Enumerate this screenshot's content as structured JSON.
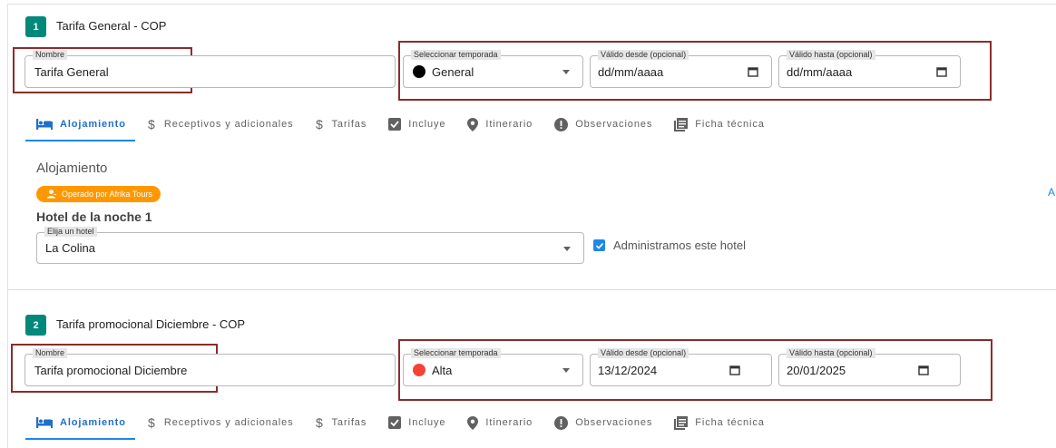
{
  "cards": [
    {
      "number": "1",
      "title": "Tarifa General - COP",
      "nombre": {
        "label": "Nombre",
        "value": "Tarifa General"
      },
      "temporada": {
        "label": "Seleccionar temporada",
        "value": "General",
        "color": "#000000"
      },
      "valido_desde": {
        "label": "Válido desde (opcional)",
        "value": "dd/mm/aaaa"
      },
      "valido_hasta": {
        "label": "Válido hasta (opcional)",
        "value": "dd/mm/aaaa"
      },
      "tabs": [
        "Alojamiento",
        "Receptivos y adicionales",
        "Tarifas",
        "Incluye",
        "Itinerario",
        "Observaciones",
        "Ficha técnica"
      ],
      "active_tab": "Alojamiento",
      "section_heading": "Alojamiento",
      "operator_badge": "Operado por Afrika Tours",
      "hotel_heading": "Hotel de la noche 1",
      "hotel_select": {
        "label": "Elija un hotel",
        "value": "La Colina"
      },
      "administramos": {
        "label": "Administramos este hotel",
        "checked": true
      },
      "edge_link": "A"
    },
    {
      "number": "2",
      "title": "Tarifa promocional Diciembre - COP",
      "nombre": {
        "label": "Nombre",
        "value": "Tarifa promocional Diciembre"
      },
      "temporada": {
        "label": "Seleccionar temporada",
        "value": "Alta",
        "color": "#f44336"
      },
      "valido_desde": {
        "label": "Válido desde (opcional)",
        "value": "13/12/2024"
      },
      "valido_hasta": {
        "label": "Válido hasta (opcional)",
        "value": "20/01/2025"
      },
      "tabs": [
        "Alojamiento",
        "Receptivos y adicionales",
        "Tarifas",
        "Incluye",
        "Itinerario",
        "Observaciones",
        "Ficha técnica"
      ],
      "active_tab": "Alojamiento"
    }
  ],
  "colors": {
    "accent": "#1e88e5",
    "badge": "#00897b",
    "operator": "#ff9800",
    "highlight": "#8b2c2c"
  },
  "icons": {
    "tabs": [
      "bed-icon",
      "dollar-icon",
      "dollar-icon",
      "checkbox-icon",
      "location-pin-icon",
      "alert-circle-icon",
      "list-icon"
    ],
    "operator": "person-icon",
    "date": "calendar-icon",
    "dropdown": "chevron-down-icon"
  }
}
